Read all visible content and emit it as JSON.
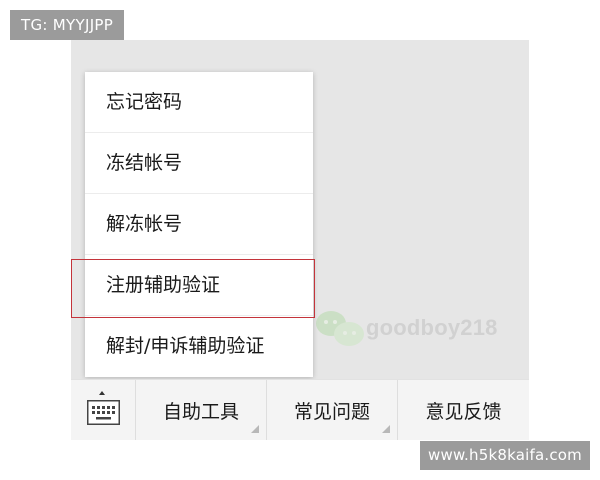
{
  "tag_badge": "TG: MYYJJPP",
  "menu": {
    "items": [
      {
        "label": "忘记密码"
      },
      {
        "label": "冻结帐号"
      },
      {
        "label": "解冻帐号"
      },
      {
        "label": "注册辅助验证"
      },
      {
        "label": "解封/申诉辅助验证"
      }
    ],
    "highlighted_index": 3
  },
  "watermark": {
    "text": "goodboy218"
  },
  "bottom_bar": {
    "keyboard_icon": "keyboard-icon",
    "tabs": [
      {
        "label": "自助工具",
        "has_submenu": true
      },
      {
        "label": "常见问题",
        "has_submenu": true
      },
      {
        "label": "意见反馈",
        "has_submenu": false
      }
    ]
  },
  "footer_badge": "www.h5k8kaifa.com",
  "colors": {
    "highlight_border": "#c4343b",
    "chat_background": "#e6e6e6",
    "badge_background": "#9b9b9b"
  }
}
